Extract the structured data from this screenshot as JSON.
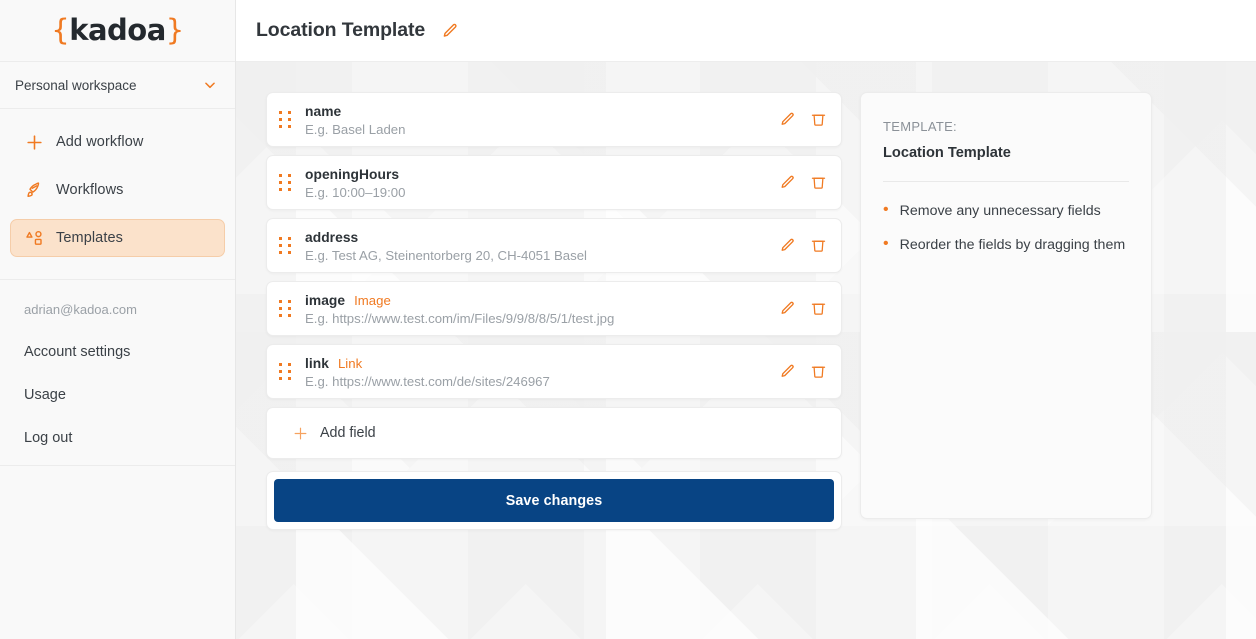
{
  "brand": {
    "logo_left_brace": "{",
    "logo_text": "kadoa",
    "logo_right_brace": "}",
    "accent_color": "#f07a22",
    "primary_button_color": "#084484"
  },
  "sidebar": {
    "workspace": {
      "label": "Personal workspace",
      "chevron_icon": "chevron-down-icon"
    },
    "nav_items": [
      {
        "label": "Add workflow",
        "icon": "plus-icon",
        "active": false
      },
      {
        "label": "Workflows",
        "icon": "rocket-icon",
        "active": false
      },
      {
        "label": "Templates",
        "icon": "shapes-icon",
        "active": true
      }
    ],
    "account": {
      "email": "adrian@kadoa.com",
      "links": [
        {
          "label": "Account settings"
        },
        {
          "label": "Usage"
        },
        {
          "label": "Log out"
        }
      ]
    }
  },
  "header": {
    "title": "Location Template",
    "edit_icon": "pencil-icon"
  },
  "fields": {
    "rows": [
      {
        "name": "name",
        "type": "",
        "example": "E.g. Basel Laden",
        "drag_handle_icon": "drag-handle-icon",
        "edit_icon": "pencil-icon",
        "delete_icon": "trash-icon"
      },
      {
        "name": "openingHours",
        "type": "",
        "example": "E.g. 10:00–19:00",
        "drag_handle_icon": "drag-handle-icon",
        "edit_icon": "pencil-icon",
        "delete_icon": "trash-icon"
      },
      {
        "name": "address",
        "type": "",
        "example": "E.g. Test AG, Steinentorberg 20, CH-4051 Basel",
        "drag_handle_icon": "drag-handle-icon",
        "edit_icon": "pencil-icon",
        "delete_icon": "trash-icon"
      },
      {
        "name": "image",
        "type": "Image",
        "example": "E.g. https://www.test.com/im/Files/9/9/8/8/5/1/test.jpg",
        "drag_handle_icon": "drag-handle-icon",
        "edit_icon": "pencil-icon",
        "delete_icon": "trash-icon"
      },
      {
        "name": "link",
        "type": "Link",
        "example": "E.g. https://www.test.com/de/sites/246967",
        "drag_handle_icon": "drag-handle-icon",
        "edit_icon": "pencil-icon",
        "delete_icon": "trash-icon"
      }
    ],
    "add_field_label": "Add field",
    "add_field_icon": "plus-icon",
    "save_label": "Save changes"
  },
  "info_panel": {
    "kicker": "TEMPLATE:",
    "title": "Location Template",
    "tips": [
      "Remove any unnecessary fields",
      "Reorder the fields by dragging them"
    ]
  }
}
